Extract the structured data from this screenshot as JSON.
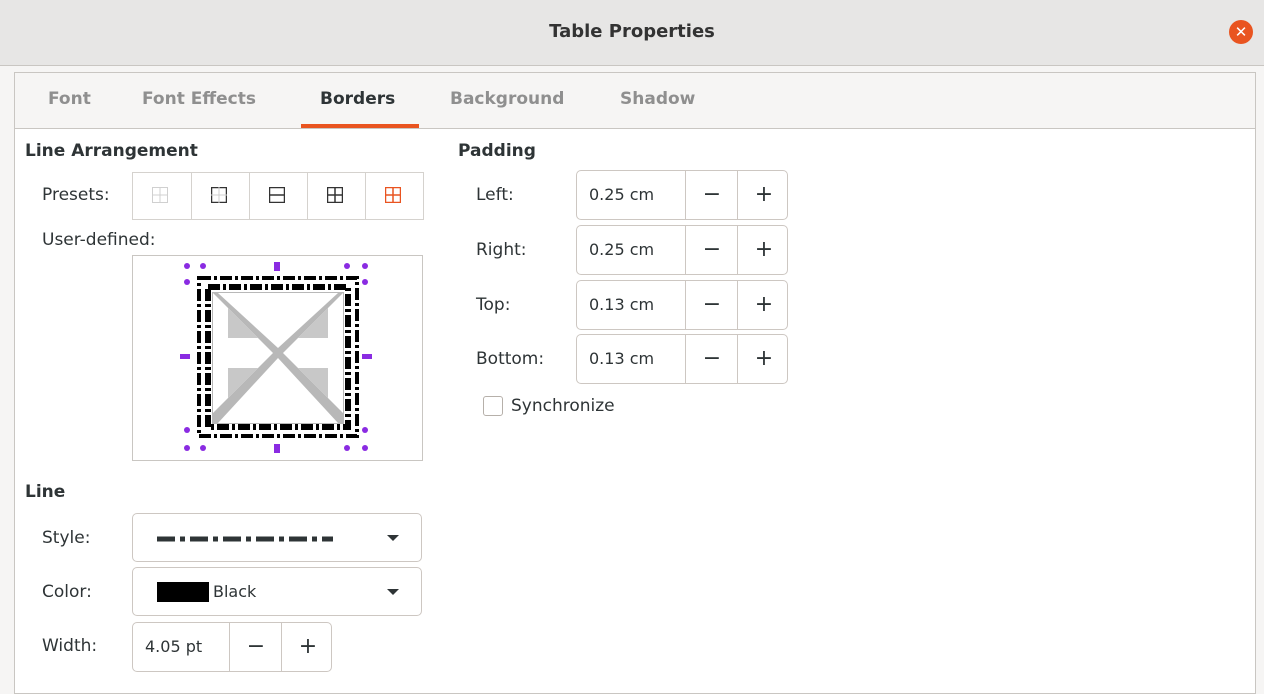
{
  "window": {
    "title": "Table Properties",
    "close_icon": "close-icon"
  },
  "tabs": [
    {
      "label": "Font",
      "active": false
    },
    {
      "label": "Font Effects",
      "active": false
    },
    {
      "label": "Borders",
      "active": true
    },
    {
      "label": "Background",
      "active": false
    },
    {
      "label": "Shadow",
      "active": false
    }
  ],
  "line_arrangement": {
    "heading": "Line Arrangement",
    "presets_label": "Presets:",
    "presets": [
      "preset-none-icon",
      "preset-outer-border-icon",
      "preset-outer-horizontal-icon",
      "preset-outer-all-inner-icon",
      "preset-outer-no-inner-icon"
    ],
    "user_defined_label": "User-defined:"
  },
  "line": {
    "heading": "Line",
    "style_label": "Style:",
    "style_value_icon": "dash-dot-line",
    "color_label": "Color:",
    "color_value": "Black",
    "color_hex": "#000000",
    "width_label": "Width:",
    "width_value": "4.05 pt"
  },
  "padding": {
    "heading": "Padding",
    "fields": [
      {
        "label": "Left:",
        "value": "0.25 cm"
      },
      {
        "label": "Right:",
        "value": "0.25 cm"
      },
      {
        "label": "Top:",
        "value": "0.13 cm"
      },
      {
        "label": "Bottom:",
        "value": "0.13 cm"
      }
    ],
    "synchronize_label": "Synchronize",
    "synchronize_checked": false
  },
  "spin_buttons": {
    "minus": "−",
    "plus": "+"
  },
  "colors": {
    "accent": "#e95420",
    "preview_marker": "#8a2be2"
  }
}
